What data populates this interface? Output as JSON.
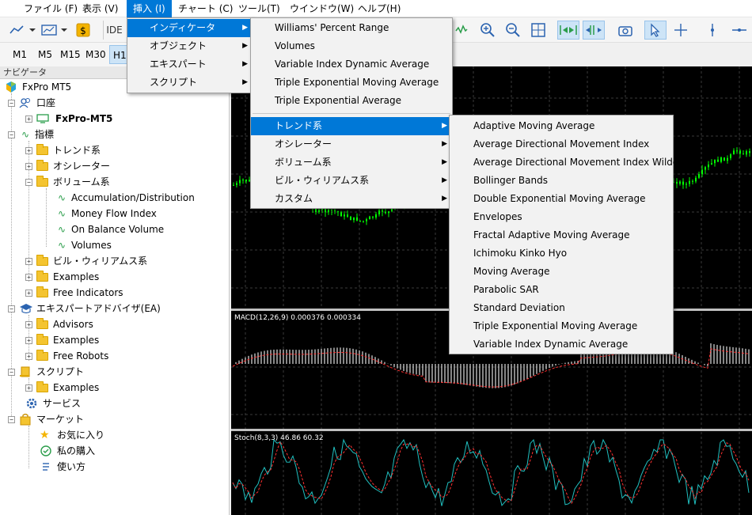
{
  "menubar": {
    "items": [
      "ファイル (F)",
      "表示 (V)",
      "挿入 (I)",
      "チャート (C)",
      "ツール(T)",
      "ウインドウ(W)",
      "ヘルプ(H)"
    ],
    "active_index": 2
  },
  "toolbar": {
    "ide_label": "IDE",
    "timeframes": [
      "M1",
      "M5",
      "M15",
      "M30",
      "H1"
    ],
    "selected_timeframe": "H1"
  },
  "navigator": {
    "title": "ナビゲータ",
    "root": "FxPro MT5",
    "accounts": {
      "label": "口座",
      "account": "FxPro-MT5"
    },
    "indicators": {
      "label": "指標",
      "folders": [
        "トレンド系",
        "オシレーター",
        "ボリューム系"
      ],
      "volume_items": [
        "Accumulation/Distribution",
        "Money Flow Index",
        "On Balance Volume",
        "Volumes"
      ],
      "more_folders": [
        "ビル・ウィリアムス系",
        "Examples",
        "Free Indicators"
      ]
    },
    "experts": {
      "label": "エキスパートアドバイザ(EA)",
      "folders": [
        "Advisors",
        "Examples",
        "Free Robots"
      ]
    },
    "scripts": {
      "label": "スクリプト",
      "folders": [
        "Examples"
      ]
    },
    "services": {
      "label": "サービス"
    },
    "market": {
      "label": "マーケット",
      "items": [
        "お気に入り",
        "私の購入",
        "使い方"
      ]
    }
  },
  "insert_menu": {
    "items": [
      "インディケータ",
      "オブジェクト",
      "エキスパート",
      "スクリプト"
    ],
    "highlighted": 0
  },
  "indicator_menu": {
    "recent": [
      "Williams' Percent Range",
      "Volumes",
      "Variable Index Dynamic Average",
      "Triple Exponential Moving Average",
      "Triple Exponential Average"
    ],
    "categories": [
      "トレンド系",
      "オシレーター",
      "ボリューム系",
      "ビル・ウィリアムス系",
      "カスタム"
    ],
    "highlighted_category": 0
  },
  "trend_menu": {
    "items": [
      "Adaptive Moving Average",
      "Average Directional Movement Index",
      "Average Directional Movement Index Wilder",
      "Bollinger Bands",
      "Double Exponential Moving Average",
      "Envelopes",
      "Fractal Adaptive Moving Average",
      "Ichimoku Kinko Hyo",
      "Moving Average",
      "Parabolic SAR",
      "Standard Deviation",
      "Triple Exponential Moving Average",
      "Variable Index Dynamic Average"
    ]
  },
  "chart": {
    "macd_label": "MACD(12,26,9) 0.000376 0.000334",
    "stoch_label": "Stoch(8,3,3) 46.86 60.32",
    "colors": {
      "bull": "#00ff00",
      "macd_hist": "#e0e0e0",
      "signal": "#ff3030",
      "stoch_main": "#20c0c0"
    }
  }
}
